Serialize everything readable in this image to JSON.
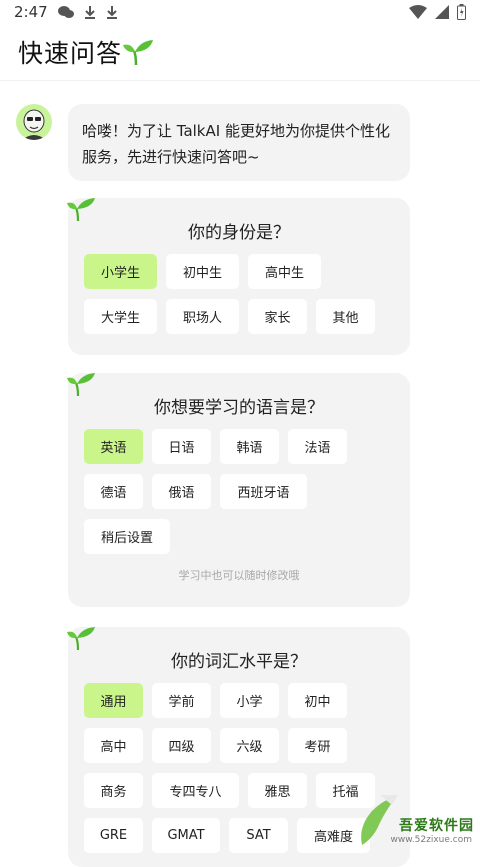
{
  "status": {
    "time": "2:47"
  },
  "header": {
    "title": "快速问答"
  },
  "intro": {
    "text": "哈喽！为了让 TalkAI 能更好地为你提供个性化服务，先进行快速问答吧~"
  },
  "identity": {
    "question": "你的身份是？",
    "options": [
      "小学生",
      "初中生",
      "高中生",
      "大学生",
      "职场人",
      "家长",
      "其他"
    ],
    "selected": "小学生"
  },
  "language": {
    "question": "你想要学习的语言是？",
    "options": [
      "英语",
      "日语",
      "韩语",
      "法语",
      "德语",
      "俄语",
      "西班牙语",
      "稍后设置"
    ],
    "selected": "英语",
    "hint": "学习中也可以随时修改哦"
  },
  "vocab": {
    "question": "你的词汇水平是？",
    "options": [
      "通用",
      "学前",
      "小学",
      "初中",
      "高中",
      "四级",
      "六级",
      "考研",
      "商务",
      "专四专八",
      "雅思",
      "托福",
      "GRE",
      "GMAT",
      "SAT",
      "高难度"
    ],
    "selected": "通用"
  },
  "watermark": {
    "title": "吾爱软件园",
    "url": "www.52zixue.com"
  },
  "colors": {
    "selected": "#caf58b",
    "card": "#f3f3f3",
    "accent": "#58c036"
  }
}
